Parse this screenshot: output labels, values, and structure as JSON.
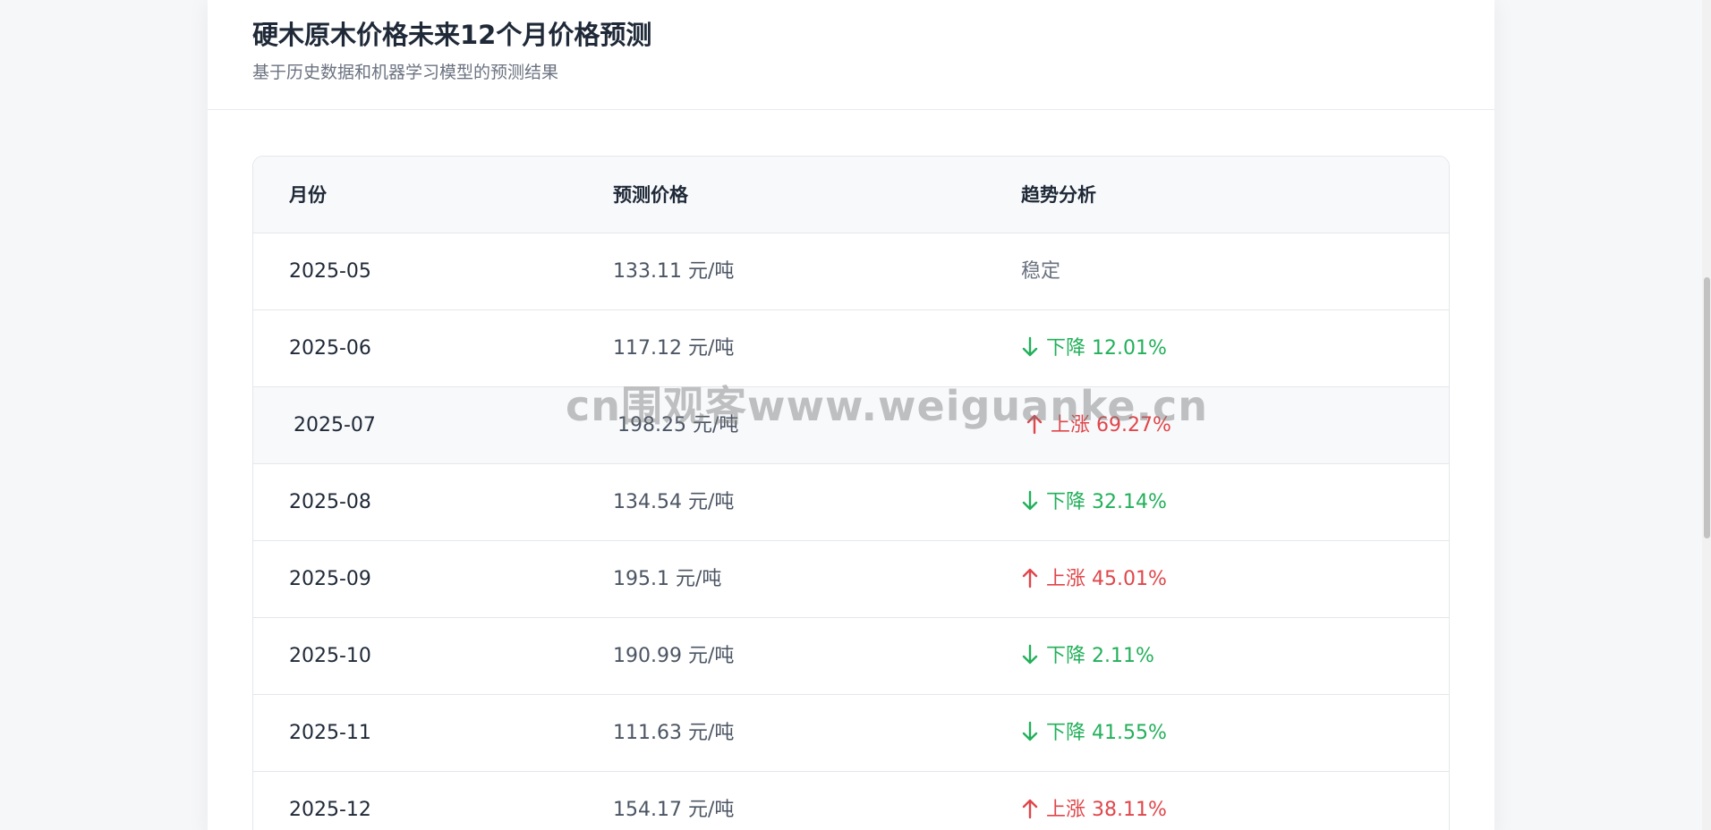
{
  "header": {
    "title": "硬木原木价格未来12个月价格预测",
    "subtitle": "基于历史数据和机器学习模型的预测结果"
  },
  "table": {
    "columns": [
      "月份",
      "预测价格",
      "趋势分析"
    ],
    "rows": [
      {
        "month": "2025-05",
        "price": "133.11 元/吨",
        "trend": "stable",
        "trend_text": "稳定"
      },
      {
        "month": "2025-06",
        "price": "117.12 元/吨",
        "trend": "down",
        "trend_text": "下降 12.01%"
      },
      {
        "month": "2025-07",
        "price": "198.25 元/吨",
        "trend": "up",
        "trend_text": "上涨 69.27%"
      },
      {
        "month": "2025-08",
        "price": "134.54 元/吨",
        "trend": "down",
        "trend_text": "下降 32.14%"
      },
      {
        "month": "2025-09",
        "price": "195.1 元/吨",
        "trend": "up",
        "trend_text": "上涨 45.01%"
      },
      {
        "month": "2025-10",
        "price": "190.99 元/吨",
        "trend": "down",
        "trend_text": "下降 2.11%"
      },
      {
        "month": "2025-11",
        "price": "111.63 元/吨",
        "trend": "down",
        "trend_text": "下降 41.55%"
      },
      {
        "month": "2025-12",
        "price": "154.17 元/吨",
        "trend": "up",
        "trend_text": "上涨 38.11%"
      }
    ]
  },
  "watermark": "cn围观客www.weiguanke.cn",
  "colors": {
    "down": "#22b05a",
    "up": "#e0464a",
    "stable": "#6b7280"
  },
  "icons": {
    "down": "arrow-down-icon",
    "up": "arrow-up-icon"
  }
}
